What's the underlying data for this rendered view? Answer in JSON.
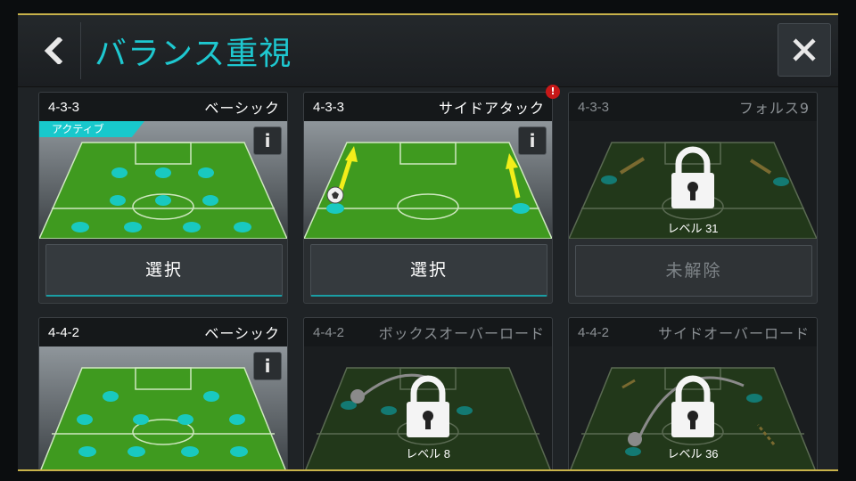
{
  "header": {
    "title": "バランス重視",
    "back_icon": "chevron-left-icon",
    "close_icon": "close-icon"
  },
  "colors": {
    "accent": "#1ec8d0",
    "gold_border": "#c8b24a",
    "pitch_green": "#3c9a1e",
    "player_dot": "#19c9c0"
  },
  "cards": [
    {
      "code": "4-3-3",
      "name": "ベーシック",
      "tag": "アクティブ",
      "button": "選択",
      "info": "i",
      "locked": false
    },
    {
      "code": "4-3-3",
      "name": "サイドアタック",
      "button": "選択",
      "info": "i",
      "alert": "!",
      "locked": false
    },
    {
      "code": "4-3-3",
      "name": "フォルス9",
      "button": "未解除",
      "lock_label": "レベル 31",
      "locked": true
    },
    {
      "code": "4-4-2",
      "name": "ベーシック",
      "info": "i",
      "locked": false
    },
    {
      "code": "4-4-2",
      "name": "ボックスオーバーロード",
      "lock_label": "レベル 8",
      "locked": true
    },
    {
      "code": "4-4-2",
      "name": "サイドオーバーロード",
      "lock_label": "レベル 36",
      "locked": true
    }
  ]
}
